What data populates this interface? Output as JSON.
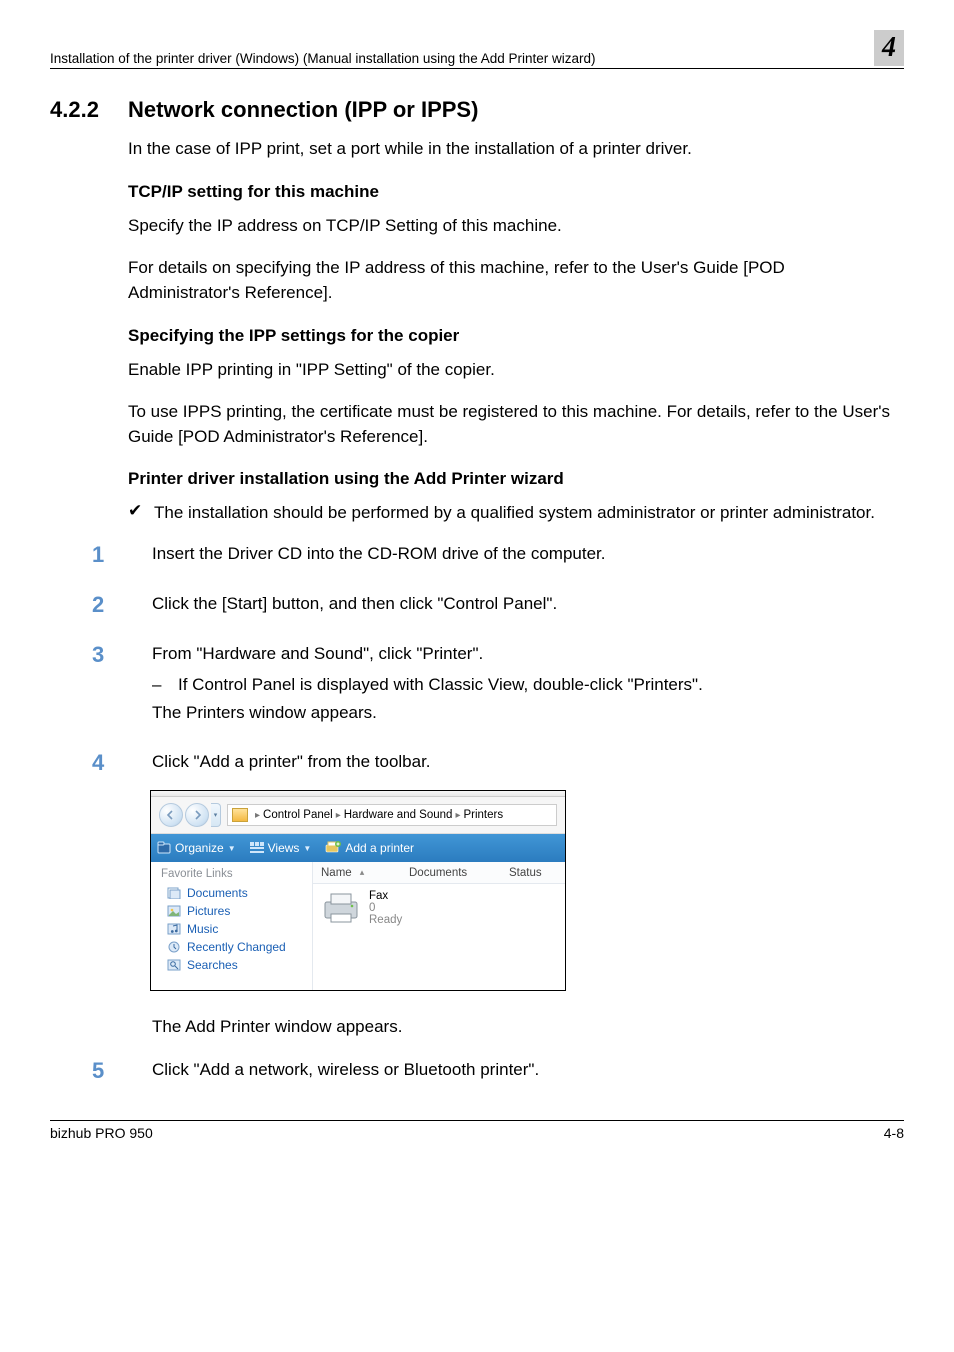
{
  "header": {
    "running_title": "Installation of the printer driver (Windows) (Manual installation using the Add Printer wizard)",
    "chapter_number": "4"
  },
  "section": {
    "number": "4.2.2",
    "title": "Network connection (IPP or IPPS)",
    "intro": "In the case of IPP print, set a port while in the installation of a printer driver."
  },
  "subs": {
    "tcpip": {
      "heading": "TCP/IP setting for this machine",
      "p1": "Specify the IP address on TCP/IP Setting of this machine.",
      "p2": "For details on specifying the IP address of this machine, refer to the User's Guide [POD Administrator's Reference]."
    },
    "ipp": {
      "heading": "Specifying the IPP settings for the copier",
      "p1": "Enable IPP printing in \"IPP Setting\" of the copier.",
      "p2": "To use IPPS printing, the certificate must be registered to this machine. For details, refer to the User's Guide [POD Administrator's Reference]."
    },
    "wizard": {
      "heading": "Printer driver installation using the Add Printer wizard",
      "check": "The installation should be performed by a qualified system administrator or printer administrator.",
      "steps": [
        {
          "n": "1",
          "text": "Insert the Driver CD into the CD-ROM drive of the computer."
        },
        {
          "n": "2",
          "text": "Click the [Start] button, and then click \"Control Panel\"."
        },
        {
          "n": "3",
          "text": "From \"Hardware and Sound\", click \"Printer\".",
          "note": "If Control Panel is displayed with Classic View, double-click \"Printers\".",
          "after": "The Printers window appears."
        },
        {
          "n": "4",
          "text": "Click \"Add a printer\" from the toolbar.",
          "after": "The Add Printer window appears."
        },
        {
          "n": "5",
          "text": "Click \"Add a network, wireless or Bluetooth printer\"."
        }
      ]
    }
  },
  "screenshot": {
    "breadcrumbs": {
      "a": "Control Panel",
      "b": "Hardware and Sound",
      "c": "Printers"
    },
    "toolbar": {
      "organize": "Organize",
      "views": "Views",
      "add_printer": "Add a printer"
    },
    "fav_heading": "Favorite Links",
    "fav_items": [
      "Documents",
      "Pictures",
      "Music",
      "Recently Changed",
      "Searches"
    ],
    "columns": {
      "name": "Name",
      "documents": "Documents",
      "status": "Status"
    },
    "printer": {
      "name": "Fax",
      "docs": "0",
      "status": "Ready"
    }
  },
  "footer": {
    "product": "bizhub PRO 950",
    "page": "4-8"
  }
}
